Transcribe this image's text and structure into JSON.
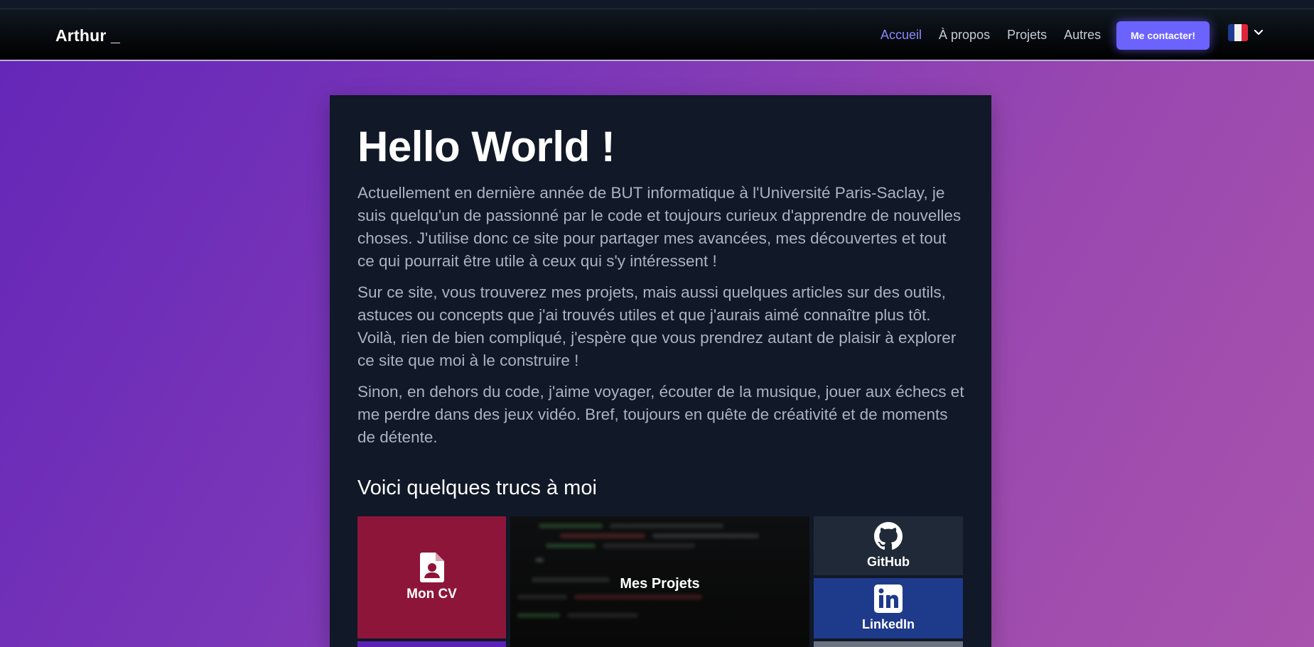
{
  "navbar": {
    "brand": "Arthur _",
    "links": [
      {
        "label": "Accueil",
        "active": true
      },
      {
        "label": "À propos",
        "active": false
      },
      {
        "label": "Projets",
        "active": false
      },
      {
        "label": "Autres",
        "active": false
      }
    ],
    "contact_label": "Me contacter!",
    "language_flag": "france-flag-icon"
  },
  "hero": {
    "title": "Hello World !",
    "paragraphs": [
      "Actuellement en dernière année de BUT informatique à l'Université Paris-Saclay, je suis quelqu'un de passionné par le code et toujours curieux d'apprendre de nouvelles choses. J'utilise donc ce site pour partager mes avancées, mes découvertes et tout ce qui pourrait être utile à ceux qui s'y intéressent !",
      "Sur ce site, vous trouverez mes projets, mais aussi quelques articles sur des outils, astuces ou concepts que j'ai trouvés utiles et que j'aurais aimé connaître plus tôt. Voilà, rien de bien compliqué, j'espère que vous prendrez autant de plaisir à explorer ce site que moi à le construire !",
      "Sinon, en dehors du code, j'aime voyager, écouter de la musique, jouer aux échecs et me perdre dans des jeux vidéo. Bref, toujours en quête de créativité et de moments de détente."
    ],
    "subtitle": "Voici quelques trucs à moi"
  },
  "tiles": {
    "cv": {
      "label": "Mon CV",
      "icon": "file-user-icon",
      "color": "#8d1539"
    },
    "projects": {
      "label": "Mes Projets"
    },
    "github": {
      "label": "GitHub",
      "icon": "github-icon",
      "color": "#1f2937"
    },
    "linkedin": {
      "label": "LinkedIn",
      "icon": "linkedin-icon",
      "color": "#1e3a8a"
    }
  },
  "colors": {
    "accent": "#6c63ff",
    "active_link": "#8b88ff"
  }
}
